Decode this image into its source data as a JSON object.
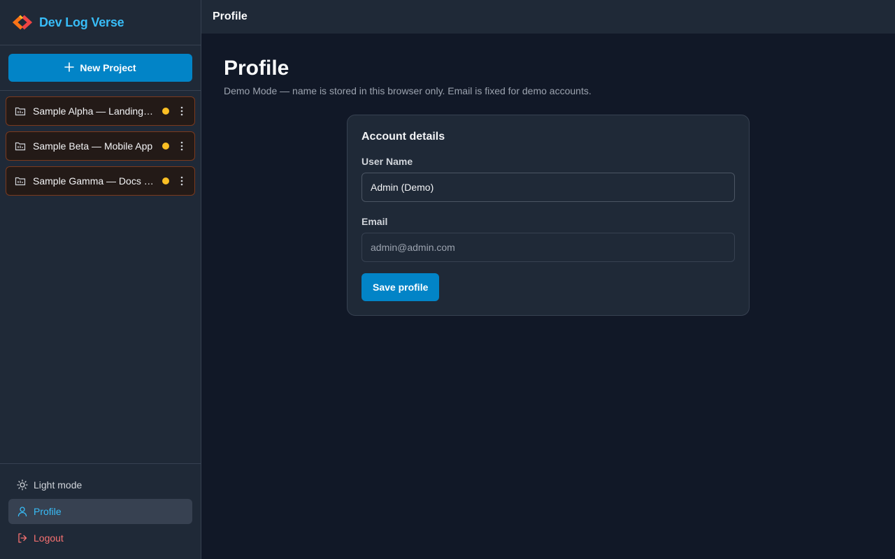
{
  "brand": {
    "title": "Dev Log Verse",
    "logo_icon": "code-brackets-logo-icon"
  },
  "sidebar": {
    "new_project_label": "New Project",
    "projects": [
      {
        "label": "Sample Alpha — Landing Page",
        "status_color": "#fbbf24"
      },
      {
        "label": "Sample Beta — Mobile App",
        "status_color": "#fbbf24"
      },
      {
        "label": "Sample Gamma — Docs Site",
        "status_color": "#fbbf24"
      }
    ],
    "footer": {
      "light_mode_label": "Light mode",
      "profile_label": "Profile",
      "logout_label": "Logout"
    }
  },
  "topbar": {
    "title": "Profile"
  },
  "page": {
    "title": "Profile",
    "subtitle": "Demo Mode — name is stored in this browser only. Email is fixed for demo accounts."
  },
  "card": {
    "title": "Account details",
    "username_label": "User Name",
    "username_value": "Admin (Demo)",
    "email_label": "Email",
    "email_value": "admin@admin.com",
    "save_label": "Save profile"
  },
  "colors": {
    "accent": "#0284c7",
    "brand_text": "#38bdf8",
    "status_pending": "#fbbf24",
    "danger": "#f87171"
  }
}
